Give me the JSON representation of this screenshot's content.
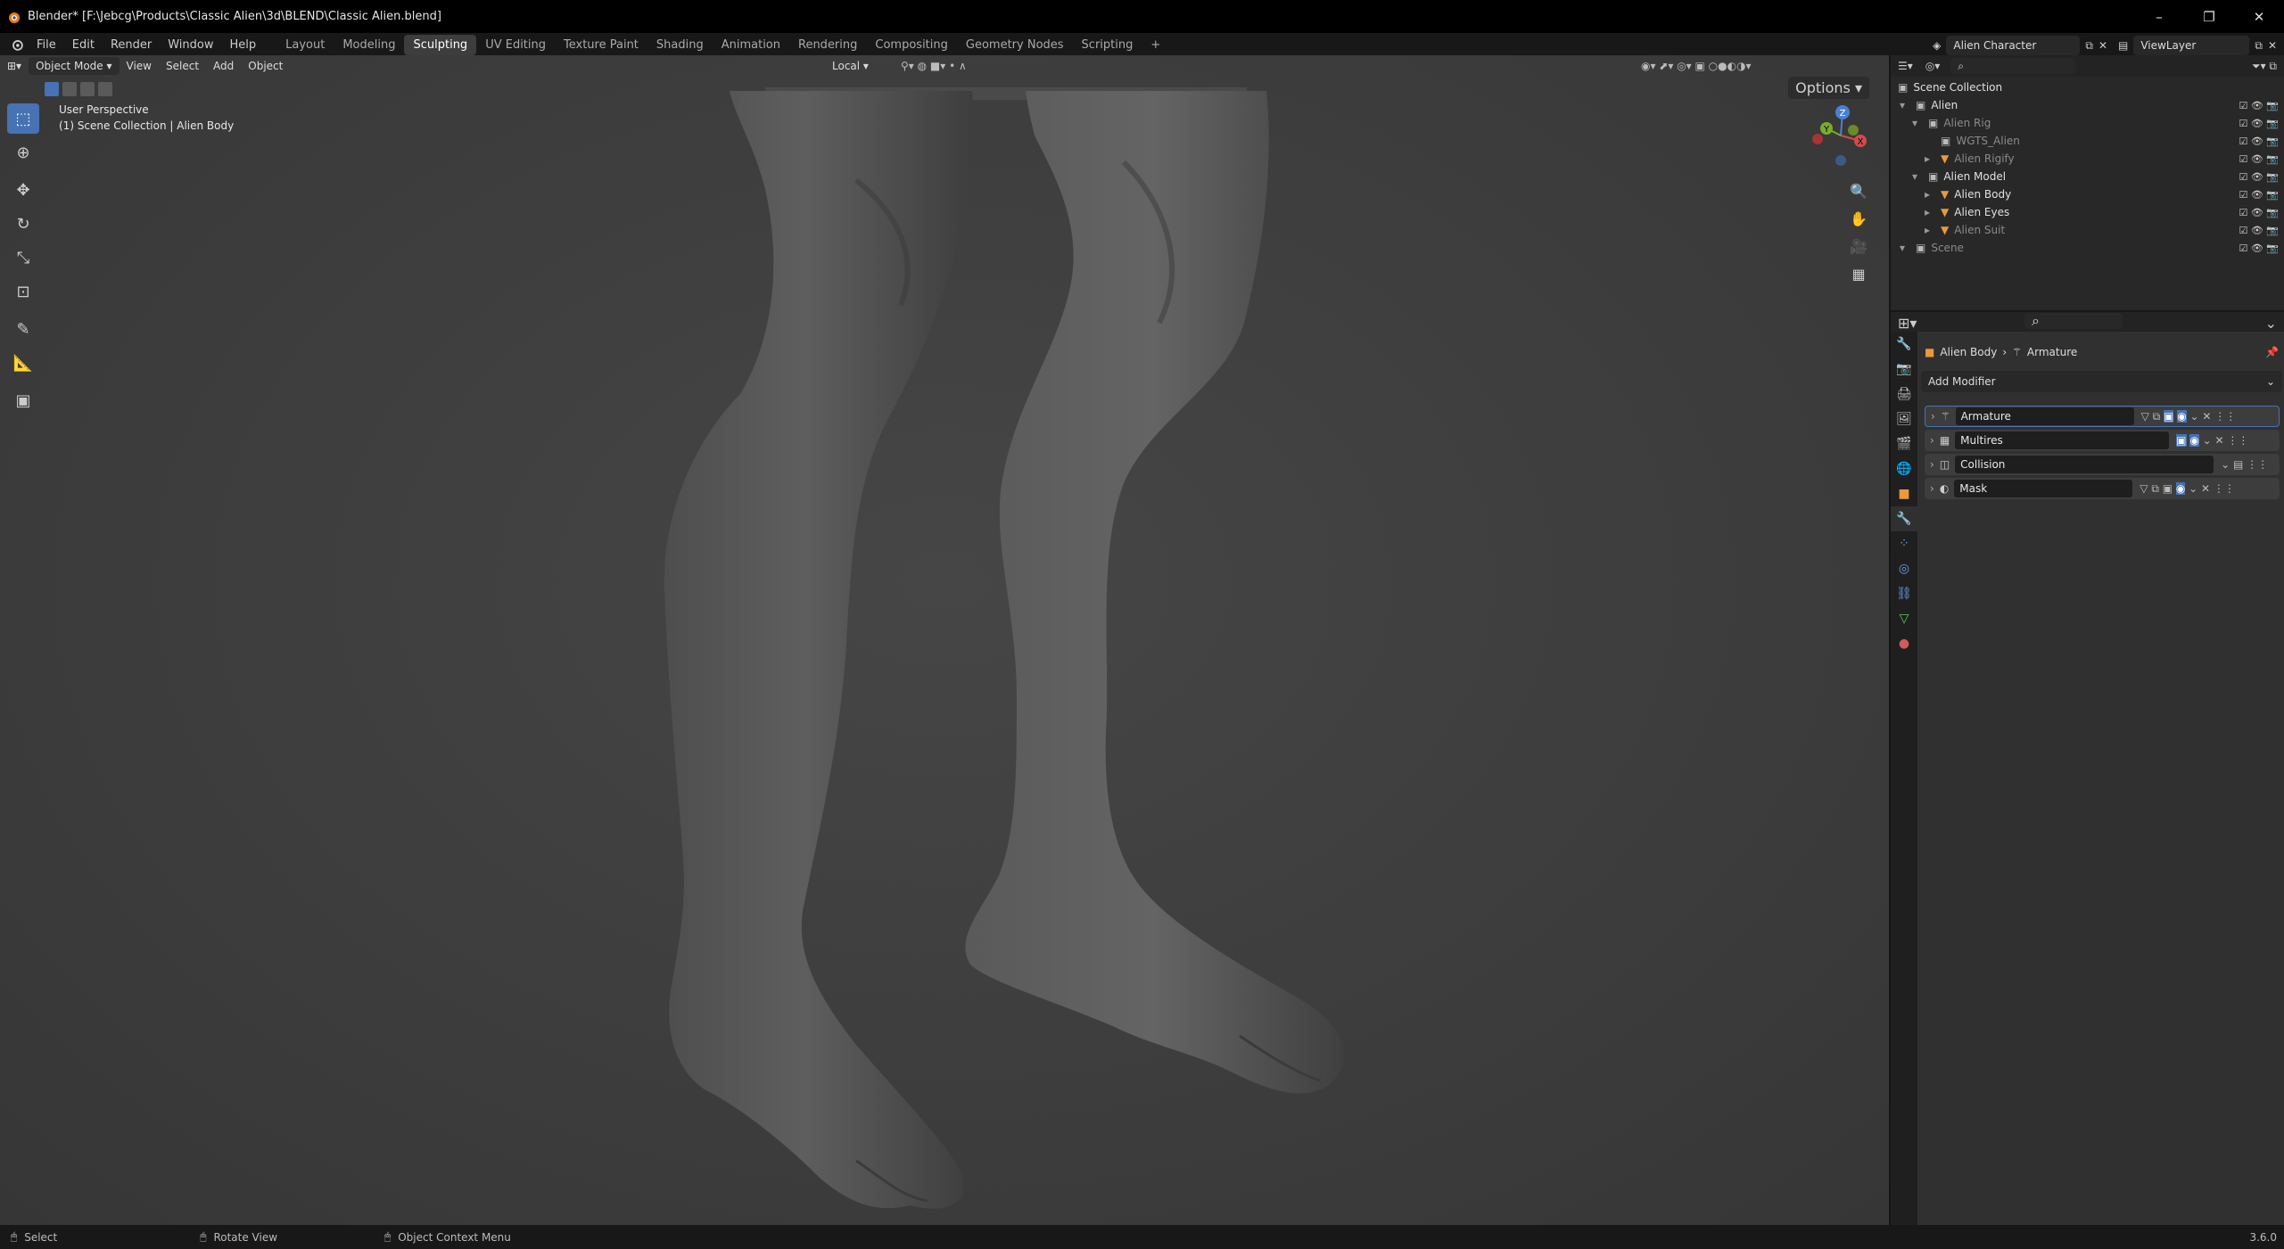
{
  "window": {
    "title": "Blender* [F:\\Jebcg\\Products\\Classic Alien\\3d\\BLEND\\Classic Alien.blend]",
    "minimize": "–",
    "maximize": "❐",
    "close": "✕"
  },
  "menus": [
    "File",
    "Edit",
    "Render",
    "Window",
    "Help"
  ],
  "workspaces": [
    "Layout",
    "Modeling",
    "Sculpting",
    "UV Editing",
    "Texture Paint",
    "Shading",
    "Animation",
    "Rendering",
    "Compositing",
    "Geometry Nodes",
    "Scripting"
  ],
  "active_workspace": "Sculpting",
  "add_workspace": "+",
  "scene_name": "Alien Character",
  "view_layer": "ViewLayer",
  "viewport": {
    "mode": "Object Mode",
    "menus": [
      "View",
      "Select",
      "Add",
      "Object"
    ],
    "transform_orientation": "Local",
    "options": "Options",
    "perspective": "User Perspective",
    "collection_info": "(1) Scene Collection | Alien Body"
  },
  "outliner": {
    "root": "Scene Collection",
    "rows": [
      {
        "label": "Alien",
        "indent": 0,
        "dim": false,
        "arrow": "▾"
      },
      {
        "label": "Alien Rig",
        "indent": 1,
        "dim": true,
        "arrow": "▾"
      },
      {
        "label": "WGTS_Alien",
        "indent": 2,
        "dim": true,
        "arrow": ""
      },
      {
        "label": "Alien Rigify",
        "indent": 2,
        "dim": true,
        "arrow": "▸"
      },
      {
        "label": "Alien Model",
        "indent": 1,
        "dim": false,
        "arrow": "▾"
      },
      {
        "label": "Alien Body",
        "indent": 2,
        "dim": false,
        "arrow": "▸"
      },
      {
        "label": "Alien Eyes",
        "indent": 2,
        "dim": false,
        "arrow": "▸"
      },
      {
        "label": "Alien Suit",
        "indent": 2,
        "dim": true,
        "arrow": "▸"
      },
      {
        "label": "Scene",
        "indent": 0,
        "dim": true,
        "arrow": "▾"
      }
    ]
  },
  "properties": {
    "breadcrumb_object": "Alien Body",
    "breadcrumb_sep": "›",
    "breadcrumb_modifier": "Armature",
    "add_modifier": "Add Modifier",
    "modifiers": [
      {
        "name": "Armature",
        "icon": "armature-icon"
      },
      {
        "name": "Multires",
        "icon": "multires-icon"
      },
      {
        "name": "Collision",
        "icon": "collision-icon"
      },
      {
        "name": "Mask",
        "icon": "mask-icon"
      }
    ]
  },
  "statusbar": {
    "select": "Select",
    "rotate": "Rotate View",
    "context": "Object Context Menu",
    "version": "3.6.0"
  },
  "colors": {
    "accent": "#4772b3",
    "background": "#3f3f3f",
    "panel": "#303030"
  }
}
